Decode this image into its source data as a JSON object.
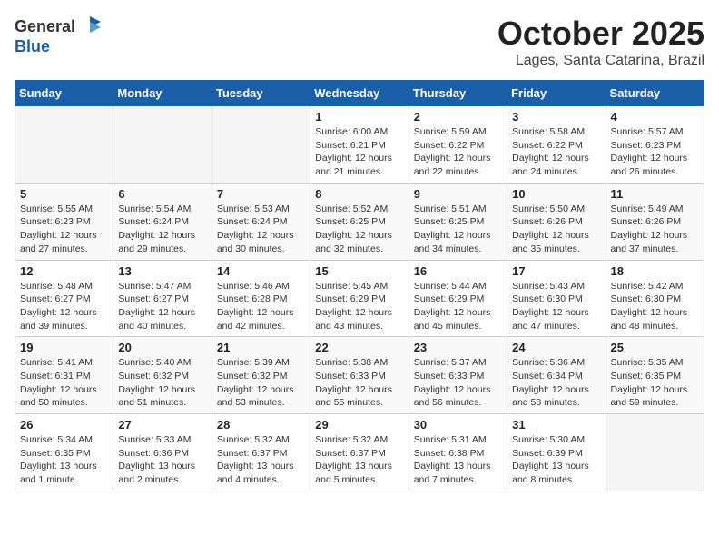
{
  "logo": {
    "general": "General",
    "blue": "Blue"
  },
  "header": {
    "month": "October 2025",
    "location": "Lages, Santa Catarina, Brazil"
  },
  "weekdays": [
    "Sunday",
    "Monday",
    "Tuesday",
    "Wednesday",
    "Thursday",
    "Friday",
    "Saturday"
  ],
  "weeks": [
    [
      {
        "day": "",
        "info": ""
      },
      {
        "day": "",
        "info": ""
      },
      {
        "day": "",
        "info": ""
      },
      {
        "day": "1",
        "info": "Sunrise: 6:00 AM\nSunset: 6:21 PM\nDaylight: 12 hours\nand 21 minutes."
      },
      {
        "day": "2",
        "info": "Sunrise: 5:59 AM\nSunset: 6:22 PM\nDaylight: 12 hours\nand 22 minutes."
      },
      {
        "day": "3",
        "info": "Sunrise: 5:58 AM\nSunset: 6:22 PM\nDaylight: 12 hours\nand 24 minutes."
      },
      {
        "day": "4",
        "info": "Sunrise: 5:57 AM\nSunset: 6:23 PM\nDaylight: 12 hours\nand 26 minutes."
      }
    ],
    [
      {
        "day": "5",
        "info": "Sunrise: 5:55 AM\nSunset: 6:23 PM\nDaylight: 12 hours\nand 27 minutes."
      },
      {
        "day": "6",
        "info": "Sunrise: 5:54 AM\nSunset: 6:24 PM\nDaylight: 12 hours\nand 29 minutes."
      },
      {
        "day": "7",
        "info": "Sunrise: 5:53 AM\nSunset: 6:24 PM\nDaylight: 12 hours\nand 30 minutes."
      },
      {
        "day": "8",
        "info": "Sunrise: 5:52 AM\nSunset: 6:25 PM\nDaylight: 12 hours\nand 32 minutes."
      },
      {
        "day": "9",
        "info": "Sunrise: 5:51 AM\nSunset: 6:25 PM\nDaylight: 12 hours\nand 34 minutes."
      },
      {
        "day": "10",
        "info": "Sunrise: 5:50 AM\nSunset: 6:26 PM\nDaylight: 12 hours\nand 35 minutes."
      },
      {
        "day": "11",
        "info": "Sunrise: 5:49 AM\nSunset: 6:26 PM\nDaylight: 12 hours\nand 37 minutes."
      }
    ],
    [
      {
        "day": "12",
        "info": "Sunrise: 5:48 AM\nSunset: 6:27 PM\nDaylight: 12 hours\nand 39 minutes."
      },
      {
        "day": "13",
        "info": "Sunrise: 5:47 AM\nSunset: 6:27 PM\nDaylight: 12 hours\nand 40 minutes."
      },
      {
        "day": "14",
        "info": "Sunrise: 5:46 AM\nSunset: 6:28 PM\nDaylight: 12 hours\nand 42 minutes."
      },
      {
        "day": "15",
        "info": "Sunrise: 5:45 AM\nSunset: 6:29 PM\nDaylight: 12 hours\nand 43 minutes."
      },
      {
        "day": "16",
        "info": "Sunrise: 5:44 AM\nSunset: 6:29 PM\nDaylight: 12 hours\nand 45 minutes."
      },
      {
        "day": "17",
        "info": "Sunrise: 5:43 AM\nSunset: 6:30 PM\nDaylight: 12 hours\nand 47 minutes."
      },
      {
        "day": "18",
        "info": "Sunrise: 5:42 AM\nSunset: 6:30 PM\nDaylight: 12 hours\nand 48 minutes."
      }
    ],
    [
      {
        "day": "19",
        "info": "Sunrise: 5:41 AM\nSunset: 6:31 PM\nDaylight: 12 hours\nand 50 minutes."
      },
      {
        "day": "20",
        "info": "Sunrise: 5:40 AM\nSunset: 6:32 PM\nDaylight: 12 hours\nand 51 minutes."
      },
      {
        "day": "21",
        "info": "Sunrise: 5:39 AM\nSunset: 6:32 PM\nDaylight: 12 hours\nand 53 minutes."
      },
      {
        "day": "22",
        "info": "Sunrise: 5:38 AM\nSunset: 6:33 PM\nDaylight: 12 hours\nand 55 minutes."
      },
      {
        "day": "23",
        "info": "Sunrise: 5:37 AM\nSunset: 6:33 PM\nDaylight: 12 hours\nand 56 minutes."
      },
      {
        "day": "24",
        "info": "Sunrise: 5:36 AM\nSunset: 6:34 PM\nDaylight: 12 hours\nand 58 minutes."
      },
      {
        "day": "25",
        "info": "Sunrise: 5:35 AM\nSunset: 6:35 PM\nDaylight: 12 hours\nand 59 minutes."
      }
    ],
    [
      {
        "day": "26",
        "info": "Sunrise: 5:34 AM\nSunset: 6:35 PM\nDaylight: 13 hours\nand 1 minute."
      },
      {
        "day": "27",
        "info": "Sunrise: 5:33 AM\nSunset: 6:36 PM\nDaylight: 13 hours\nand 2 minutes."
      },
      {
        "day": "28",
        "info": "Sunrise: 5:32 AM\nSunset: 6:37 PM\nDaylight: 13 hours\nand 4 minutes."
      },
      {
        "day": "29",
        "info": "Sunrise: 5:32 AM\nSunset: 6:37 PM\nDaylight: 13 hours\nand 5 minutes."
      },
      {
        "day": "30",
        "info": "Sunrise: 5:31 AM\nSunset: 6:38 PM\nDaylight: 13 hours\nand 7 minutes."
      },
      {
        "day": "31",
        "info": "Sunrise: 5:30 AM\nSunset: 6:39 PM\nDaylight: 13 hours\nand 8 minutes."
      },
      {
        "day": "",
        "info": ""
      }
    ]
  ]
}
